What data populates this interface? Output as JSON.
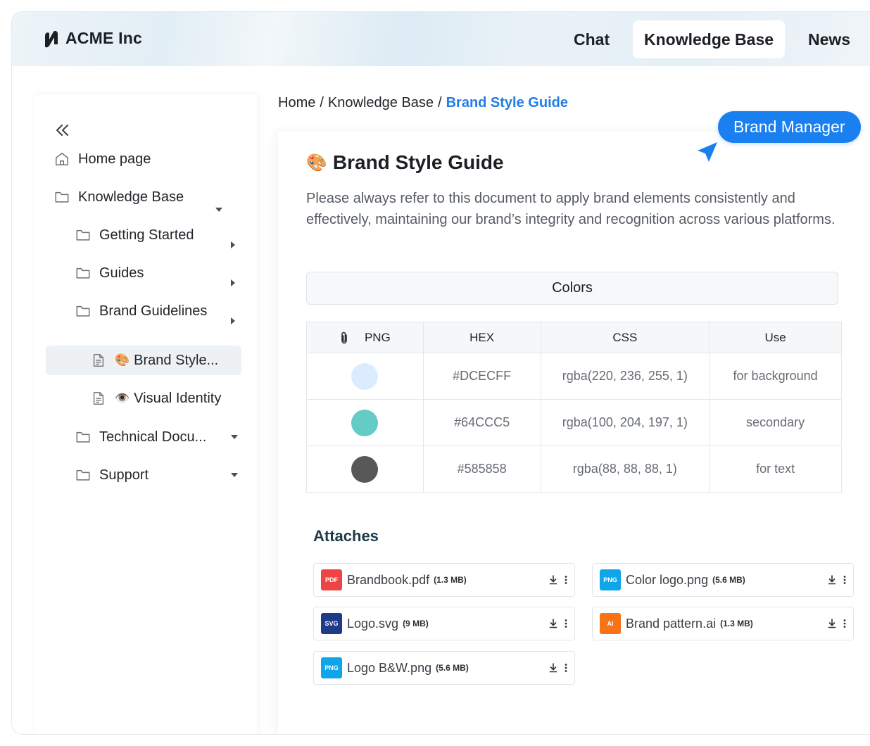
{
  "header": {
    "brand": "ACME Inc",
    "nav": [
      {
        "label": "Chat",
        "active": false
      },
      {
        "label": "Knowledge Base",
        "active": true
      },
      {
        "label": "News",
        "active": false
      }
    ]
  },
  "sidebar": {
    "items": [
      {
        "label": "Home page",
        "icon": "home-icon"
      },
      {
        "label": "Knowledge Base",
        "icon": "folder-icon",
        "expanded": true
      },
      {
        "label": "Getting Started",
        "icon": "folder-icon"
      },
      {
        "label": "Guides",
        "icon": "folder-icon"
      },
      {
        "label": "Brand Guidelines",
        "icon": "folder-icon"
      },
      {
        "label": "Brand Style...",
        "icon": "document-icon",
        "emoji": "🎨",
        "active": true
      },
      {
        "label": "Visual Identity",
        "icon": "document-icon",
        "emoji": "👁️"
      },
      {
        "label": "Technical Docu...",
        "icon": "folder-icon",
        "expanded": true
      },
      {
        "label": "Support",
        "icon": "folder-icon",
        "expanded": true
      }
    ]
  },
  "breadcrumb": {
    "home": "Home",
    "section": "Knowledge Base",
    "current": "Brand Style Guide"
  },
  "badge": "Brand Manager",
  "document": {
    "emoji": "🎨",
    "title": "Brand Style Guide",
    "description": "Please always refer to this document to apply brand elements consistently and effectively, maintaining our brand’s integrity and recognition across various platforms."
  },
  "colors": {
    "section_label": "Colors",
    "headers": {
      "png": "PNG",
      "hex": "HEX",
      "css": "CSS",
      "use": "Use"
    },
    "rows": [
      {
        "swatch": "#DCECFF",
        "hex": "#DCECFF",
        "css": "rgba(220, 236, 255, 1)",
        "use": "for background"
      },
      {
        "swatch": "#64CCC5",
        "hex": "#64CCC5",
        "css": "rgba(100, 204, 197, 1)",
        "use": "secondary"
      },
      {
        "swatch": "#585858",
        "hex": "#585858",
        "css": "rgba(88, 88, 88, 1)",
        "use": "for text"
      }
    ]
  },
  "attaches": {
    "title": "Attaches",
    "files": [
      {
        "type": "PDF",
        "color": "#ef4444",
        "name": "Brandbook.pdf",
        "size": "(1.3 MB)"
      },
      {
        "type": "PNG",
        "color": "#0ea5e9",
        "name": "Color logo.png",
        "size": "(5.6 MB)"
      },
      {
        "type": "SVG",
        "color": "#1e3a8a",
        "name": "Logo.svg",
        "size": "(9 MB)"
      },
      {
        "type": "AI",
        "color": "#f97316",
        "name": "Brand pattern.ai",
        "size": "(1.3 MB)"
      },
      {
        "type": "PNG",
        "color": "#0ea5e9",
        "name": "Logo B&W.png",
        "size": "(5.6 MB)"
      }
    ]
  },
  "theme": {
    "accent": "#1a7fef",
    "link": "#1e7de6"
  }
}
